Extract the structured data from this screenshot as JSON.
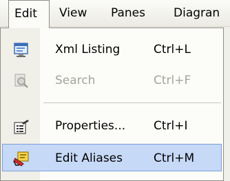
{
  "menubar": {
    "items": [
      {
        "label": "Edit"
      },
      {
        "label": "View"
      },
      {
        "label": "Panes"
      },
      {
        "label": "Diagran"
      }
    ]
  },
  "menu": {
    "items": [
      {
        "label": "Xml Listing",
        "shortcut": "Ctrl+L",
        "icon": "xml-listing-icon",
        "enabled": true
      },
      {
        "label": "Search",
        "shortcut": "Ctrl+F",
        "icon": "search-icon",
        "enabled": false
      },
      {
        "label": "Properties...",
        "shortcut": "Ctrl+I",
        "icon": "properties-icon",
        "enabled": true
      },
      {
        "label": "Edit Aliases",
        "shortcut": "Ctrl+M",
        "icon": "edit-aliases-icon",
        "enabled": true,
        "highlighted": true
      }
    ]
  },
  "colors": {
    "highlight": "#c6d9f7",
    "highlight_border": "#7ca0d8",
    "disabled_text": "#a4a39c"
  }
}
